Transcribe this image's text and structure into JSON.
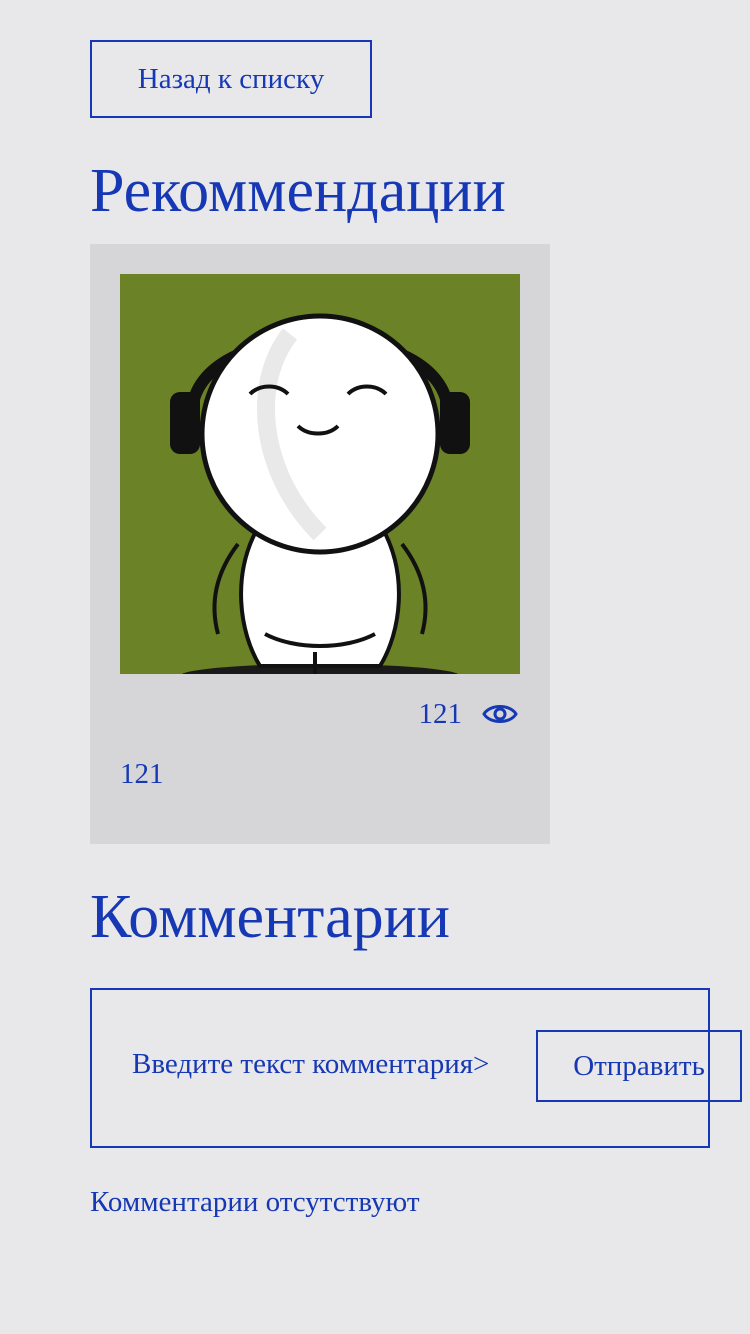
{
  "nav": {
    "back_label": "Назад к списку"
  },
  "recommendations": {
    "title": "Рекоммендации",
    "card": {
      "image_icon": "cartoon-character-headphones",
      "views": "121",
      "views_icon": "eye-icon",
      "caption": "121"
    }
  },
  "comments": {
    "title": "Комментарии",
    "input_text": "Введите текст комментария>",
    "send_label": "Отправить",
    "empty_text": "Комментарии отсутствуют"
  },
  "colors": {
    "accent": "#1638b4",
    "background": "#e8e8eb",
    "card_background": "#d6d6d9",
    "image_background": "#6b8326"
  }
}
